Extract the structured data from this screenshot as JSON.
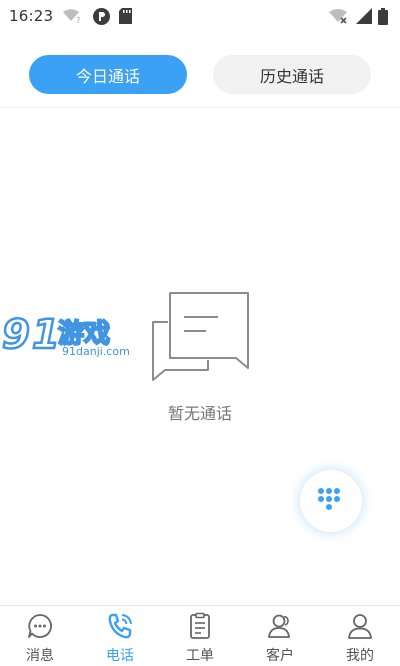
{
  "status_bar": {
    "time": "16:23",
    "icons": [
      "wifi-question-icon",
      "app-notification-icon",
      "sd-card-icon",
      "wifi-off-icon",
      "cell-signal-icon",
      "battery-icon"
    ]
  },
  "tabs": {
    "today_label": "今日通话",
    "history_label": "历史通话"
  },
  "empty_state": {
    "icon": "empty-chat-icon",
    "message": "暂无通话"
  },
  "watermark": {
    "brand": "91游戏",
    "domain": "91danji.com"
  },
  "dial_button": {
    "icon": "dialpad-icon"
  },
  "bottom_nav": {
    "active_color": "#3aa1f5",
    "items": [
      {
        "label": "消息",
        "icon": "chat-bubble-icon"
      },
      {
        "label": "电话",
        "icon": "phone-icon"
      },
      {
        "label": "工单",
        "icon": "clipboard-icon"
      },
      {
        "label": "客户",
        "icon": "customers-icon"
      },
      {
        "label": "我的",
        "icon": "profile-icon"
      }
    ]
  }
}
